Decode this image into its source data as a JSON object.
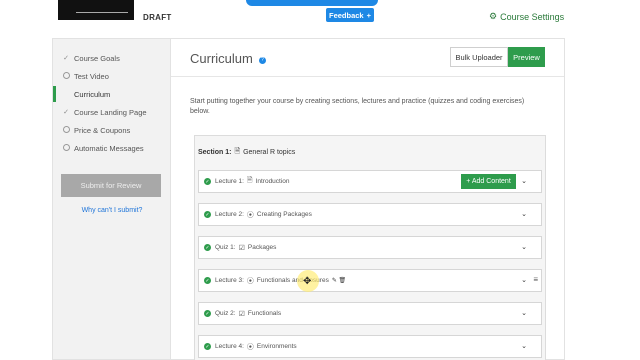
{
  "header": {
    "status": "DRAFT",
    "feedback_label": "Feedback",
    "feedback_icon": "+",
    "settings_label": "Course Settings",
    "settings_icon": "gear-icon"
  },
  "sidebar": {
    "items": [
      {
        "label": "Course Goals",
        "state": "done"
      },
      {
        "label": "Test Video",
        "state": "todo"
      },
      {
        "label": "Curriculum",
        "state": "active"
      },
      {
        "label": "Course Landing Page",
        "state": "done"
      },
      {
        "label": "Price & Coupons",
        "state": "todo"
      },
      {
        "label": "Automatic Messages",
        "state": "todo"
      }
    ],
    "submit_label": "Submit for Review",
    "why_link": "Why can't I submit?"
  },
  "main": {
    "title": "Curriculum",
    "help_icon": "?",
    "bulk_label": "Bulk Uploader",
    "preview_label": "Preview",
    "intro": "Start putting together your course by creating sections, lectures and practice (quizzes and coding exercises) below."
  },
  "section": {
    "label": "Section 1:",
    "title": "General R topics",
    "items": [
      {
        "type": "Lecture 1:",
        "icon": "document-icon",
        "title": "Introduction",
        "add_content": "+ Add Content"
      },
      {
        "type": "Lecture 2:",
        "icon": "play-icon",
        "title": "Creating Packages"
      },
      {
        "type": "Quiz 1:",
        "icon": "quiz-icon",
        "title": "Packages"
      },
      {
        "type": "Lecture 3:",
        "icon": "play-icon",
        "title": "Functionals and closures"
      },
      {
        "type": "Quiz 2:",
        "icon": "quiz-icon",
        "title": "Functionals"
      },
      {
        "type": "Lecture 4:",
        "icon": "play-icon",
        "title": "Environments"
      }
    ]
  },
  "colors": {
    "accent_green": "#2e9c4c",
    "accent_blue": "#1e88e5"
  }
}
